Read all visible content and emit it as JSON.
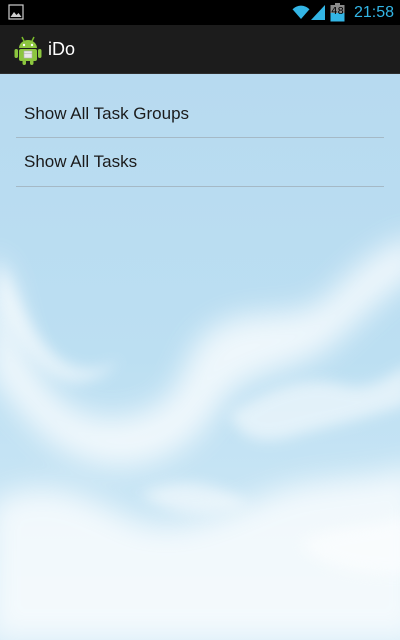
{
  "status_bar": {
    "time": "21:58",
    "battery_level": "48",
    "icons": [
      "image-notification-icon",
      "wifi-icon",
      "signal-icon",
      "battery-icon"
    ],
    "accent_color": "#33b5e5"
  },
  "action_bar": {
    "app_icon": "android-app-icon",
    "title": "iDo"
  },
  "main": {
    "items": [
      {
        "label": "Show All Task Groups"
      },
      {
        "label": "Show All Tasks"
      }
    ]
  },
  "colors": {
    "background": "#b9dcf1",
    "action_bar": "#1c1c1c",
    "divider": "#a5b9c6",
    "text": "#1b1b1b"
  }
}
